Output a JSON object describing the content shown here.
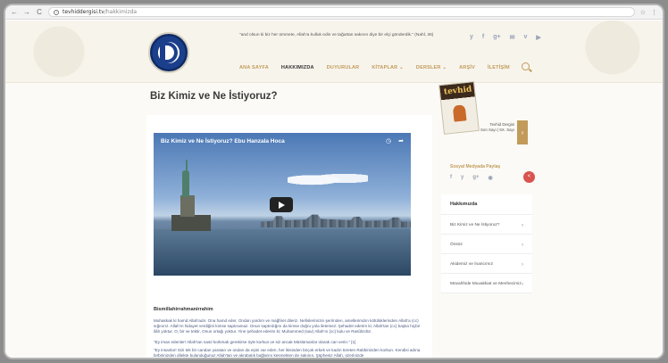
{
  "browser": {
    "back": "←",
    "forward": "→",
    "reload": "C",
    "info": "i",
    "url_host": "tevhiddergisi.tv",
    "url_path": "/hakkimizda",
    "star": "☆",
    "menu": "⋮"
  },
  "header": {
    "quote": "\"and olsun ki biz her ümmete, Allah'a kulluk edin ve tağuttan sakının diye bir elçi gönderdik.\" (Nahl, 36)",
    "social": [
      "y",
      "f",
      "g+",
      "✉",
      "v",
      "▶"
    ],
    "menu": [
      "ANA SAYFA",
      "HAKKIMIZDA",
      "DUYURULAR",
      "KİTAPLAR ⌄",
      "DERSLER ⌄",
      "ARŞİV",
      "İLETİŞİM"
    ],
    "active_menu": "HAKKIMIZDA"
  },
  "page": {
    "title": "Biz Kimiz ve Ne İstiyoruz?"
  },
  "video": {
    "title": "Biz Kimiz ve Ne İstiyoruz? Ebu Hanzala Hoca",
    "clock_icon": "◷",
    "share_icon": "➦"
  },
  "content": {
    "bismillah": "Bismillahirrahmanirrahim",
    "paragraphs": [
      "Muhakkak ki hamd Allah'adır. Ona hamd eder, Ondan yardım ve mağfiret dileriz. Nefislerimizin şerrinden, amellerimizin kötülüklerinden Allah'a (cc) sığınırız. Allah'ın hidayet verdiğini kimse saptıramaz. Onun saptırdığını da kimse doğru yola iletemez. Şehadet ederim ki; Allah'tan (cc) başka hiçbir ilâh yoktur. O, bir ve tektir, Onun ortağı yoktur. Yine şehadet ederim ki; Muhammed (sav) Allah'ın (cc) kulu ve Rasûlü'dür.",
      "\"Ey iman edenler! Allah'tan nasıl korkmak gerekirse öyle korkun ve siz ancak Müslümanlar olarak can verin.\" [1]",
      "\"Ey insanlar! Sizi tek bir candan yaratan ve ondan da eşini var eden, her ikisinden birçok erkek ve kadın türeten Rabbinizden korkun. Kendisi adına birbirinizden dilekte bulunduğunuz Allah'tan ve akrabalık bağlarını kesmekten de sakının. Şüphesiz Allah, üzerinizde"
    ]
  },
  "sidebar": {
    "magazine_brand": "tevhid",
    "magazine_caption_1": "Tevhid Dergisi",
    "magazine_caption_2": "Son Sayı | 5X. Sayı",
    "magazine_arrow": "›",
    "share_title": "Sosyal Medyada Paylaş",
    "share_icons": [
      "f",
      "y",
      "g+",
      "◉"
    ],
    "share_button": "<",
    "menu_title": "Hakkımızda",
    "menu_items": [
      "Biz Kimiz ve Ne İstiyoruz?",
      "Önsöz",
      "Akidemiz ve İnancımız",
      "Müvahhide Muvakkiat ve Menhecimiz"
    ],
    "chevron": "›"
  },
  "colors": {
    "accent": "#c29b5a",
    "logo_blue": "#1c3f8c",
    "share_red": "#d9534f"
  }
}
